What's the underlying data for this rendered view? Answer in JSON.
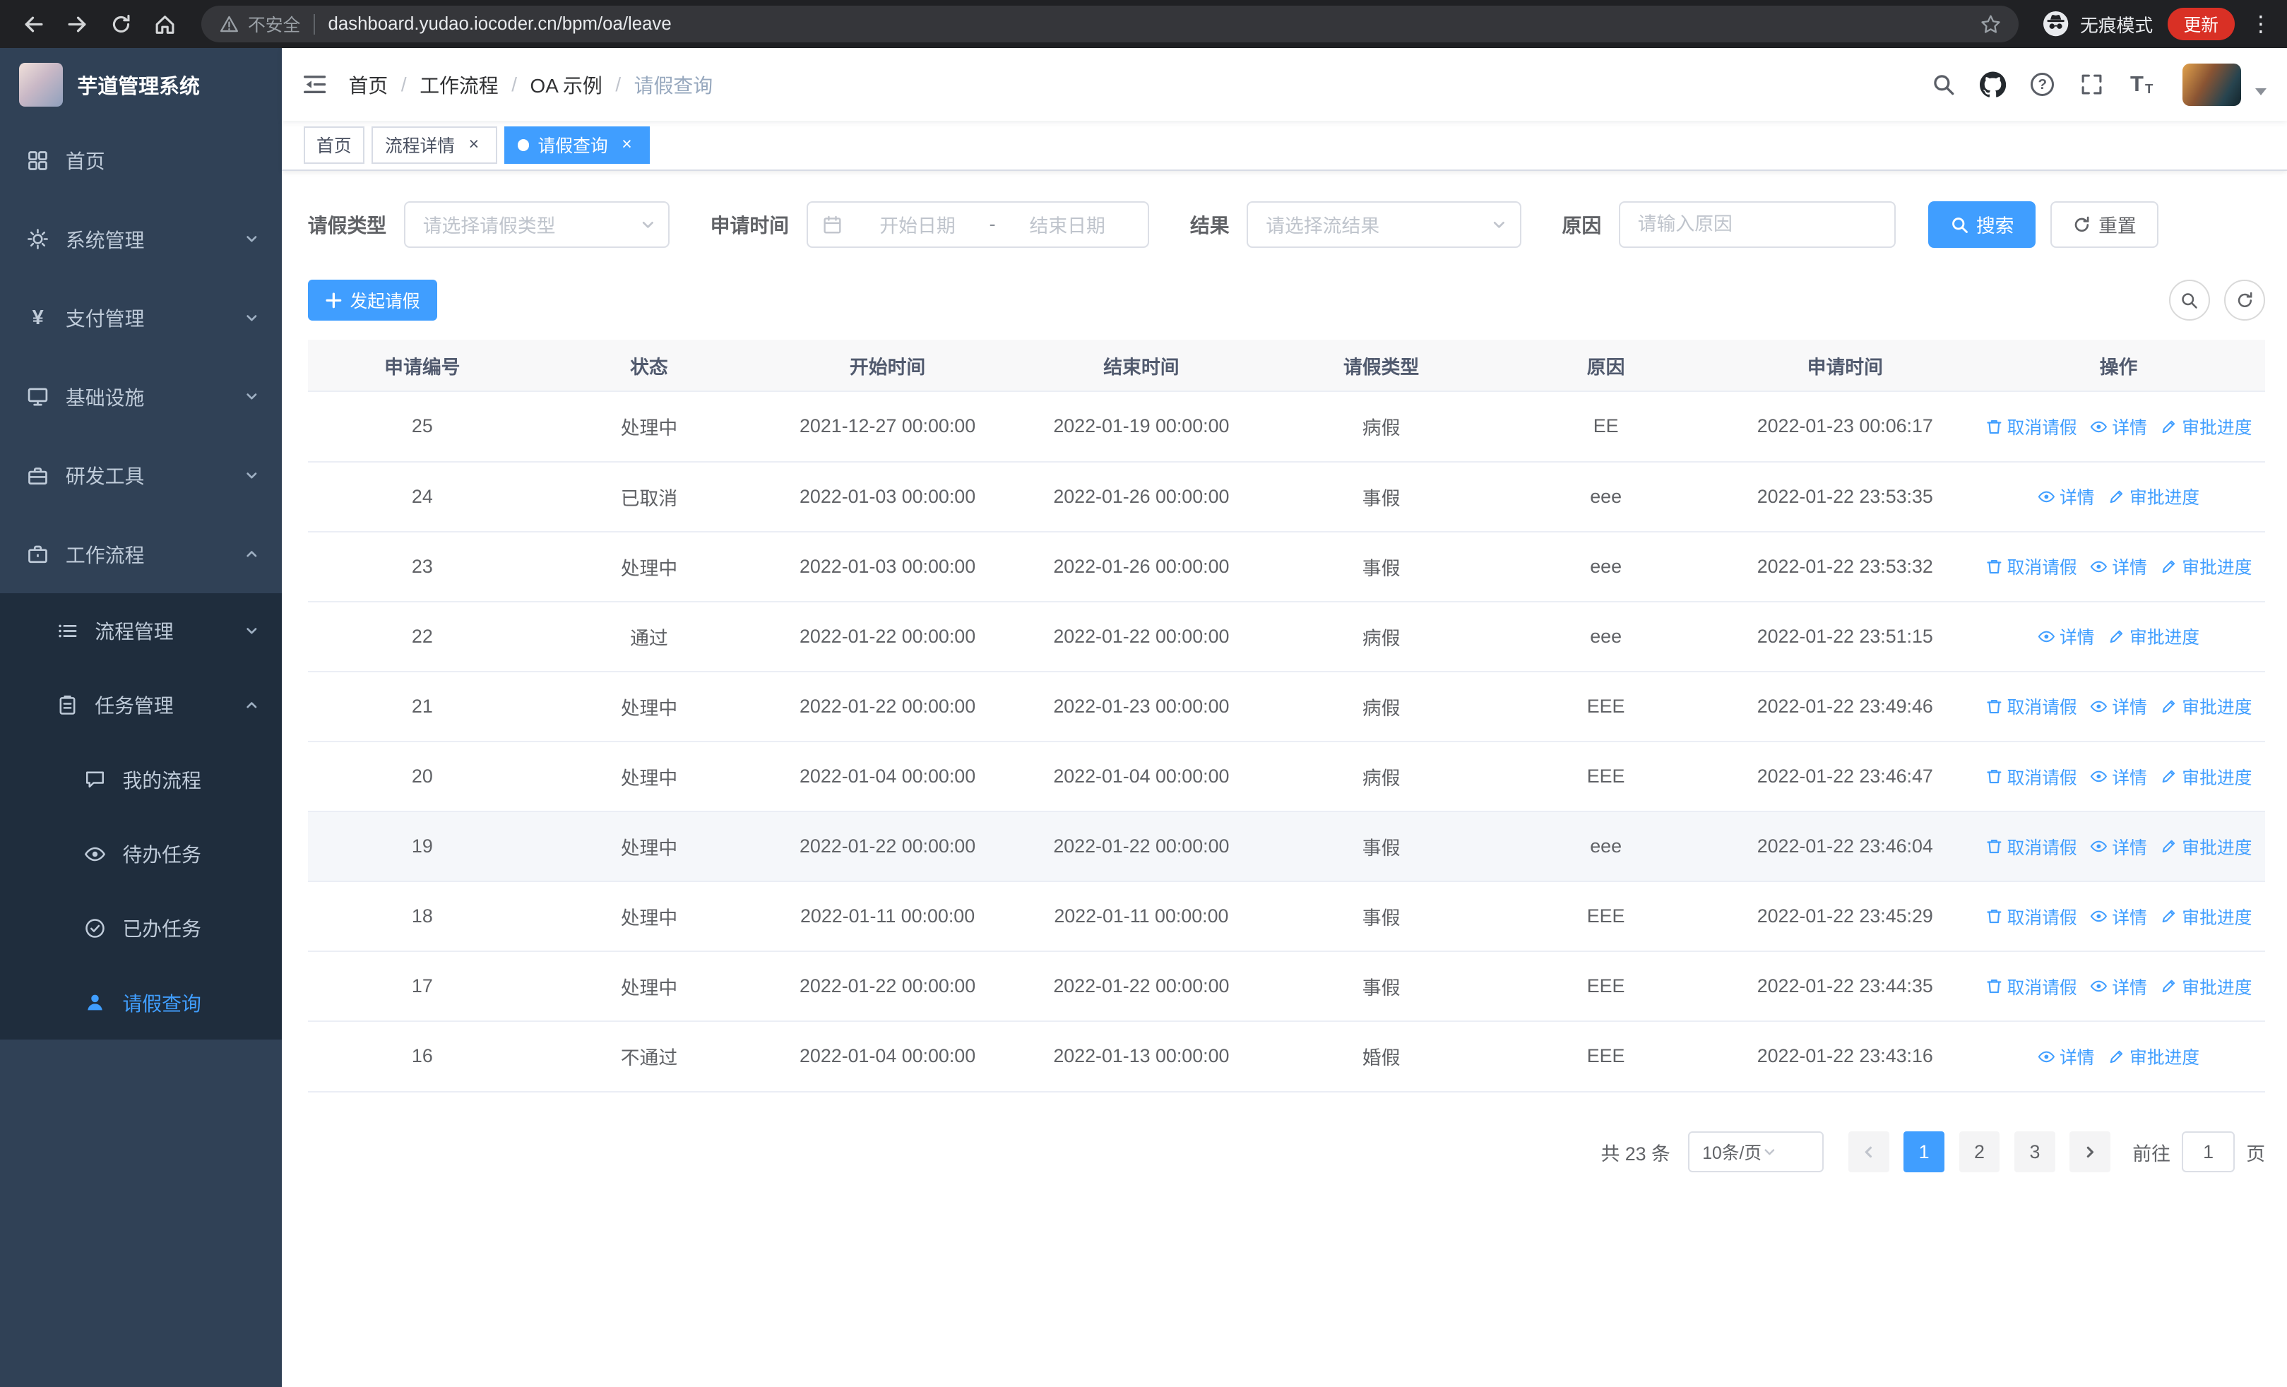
{
  "browser": {
    "security_label": "不安全",
    "url": "dashboard.yudao.iocoder.cn/bpm/oa/leave",
    "incognito_label": "无痕模式",
    "update_label": "更新"
  },
  "sidebar": {
    "app_title": "芋道管理系统",
    "items": [
      {
        "label": "首页",
        "level": 1
      },
      {
        "label": "系统管理",
        "level": 1,
        "chevron": "down"
      },
      {
        "label": "支付管理",
        "level": 1,
        "chevron": "down"
      },
      {
        "label": "基础设施",
        "level": 1,
        "chevron": "down"
      },
      {
        "label": "研发工具",
        "level": 1,
        "chevron": "down"
      },
      {
        "label": "工作流程",
        "level": 1,
        "chevron": "up",
        "expanded": true
      },
      {
        "label": "流程管理",
        "level": 2,
        "chevron": "down"
      },
      {
        "label": "任务管理",
        "level": 2,
        "chevron": "up",
        "expanded": true
      },
      {
        "label": "我的流程",
        "level": 3
      },
      {
        "label": "待办任务",
        "level": 3
      },
      {
        "label": "已办任务",
        "level": 3
      },
      {
        "label": "请假查询",
        "level": 3,
        "active": true
      }
    ]
  },
  "header": {
    "breadcrumb": [
      "首页",
      "工作流程",
      "OA 示例",
      "请假查询"
    ],
    "breadcrumb_separator": "/"
  },
  "tabs": [
    {
      "label": "首页",
      "active": false,
      "closable": false
    },
    {
      "label": "流程详情",
      "active": false,
      "closable": true
    },
    {
      "label": "请假查询",
      "active": true,
      "closable": true
    }
  ],
  "filters": {
    "leave_type_label": "请假类型",
    "leave_type_placeholder": "请选择请假类型",
    "apply_time_label": "申请时间",
    "start_date_placeholder": "开始日期",
    "range_separator": "-",
    "end_date_placeholder": "结束日期",
    "result_label": "结果",
    "result_placeholder": "请选择流结果",
    "reason_label": "原因",
    "reason_placeholder": "请输入原因",
    "search_button": "搜索",
    "reset_button": "重置"
  },
  "toolbar": {
    "create_button": "发起请假"
  },
  "table": {
    "columns": [
      "申请编号",
      "状态",
      "开始时间",
      "结束时间",
      "请假类型",
      "原因",
      "申请时间",
      "操作"
    ],
    "action_labels": {
      "cancel": "取消请假",
      "detail": "详情",
      "progress": "审批进度"
    },
    "rows": [
      {
        "id": "25",
        "status": "处理中",
        "start": "2021-12-27 00:00:00",
        "end": "2022-01-19 00:00:00",
        "type": "病假",
        "reason": "EE",
        "applied": "2022-01-23 00:06:17",
        "actions": [
          "cancel",
          "detail",
          "progress"
        ],
        "highlighted": false
      },
      {
        "id": "24",
        "status": "已取消",
        "start": "2022-01-03 00:00:00",
        "end": "2022-01-26 00:00:00",
        "type": "事假",
        "reason": "eee",
        "applied": "2022-01-22 23:53:35",
        "actions": [
          "detail",
          "progress"
        ],
        "highlighted": false
      },
      {
        "id": "23",
        "status": "处理中",
        "start": "2022-01-03 00:00:00",
        "end": "2022-01-26 00:00:00",
        "type": "事假",
        "reason": "eee",
        "applied": "2022-01-22 23:53:32",
        "actions": [
          "cancel",
          "detail",
          "progress"
        ],
        "highlighted": false
      },
      {
        "id": "22",
        "status": "通过",
        "start": "2022-01-22 00:00:00",
        "end": "2022-01-22 00:00:00",
        "type": "病假",
        "reason": "eee",
        "applied": "2022-01-22 23:51:15",
        "actions": [
          "detail",
          "progress"
        ],
        "highlighted": false
      },
      {
        "id": "21",
        "status": "处理中",
        "start": "2022-01-22 00:00:00",
        "end": "2022-01-23 00:00:00",
        "type": "病假",
        "reason": "EEE",
        "applied": "2022-01-22 23:49:46",
        "actions": [
          "cancel",
          "detail",
          "progress"
        ],
        "highlighted": false
      },
      {
        "id": "20",
        "status": "处理中",
        "start": "2022-01-04 00:00:00",
        "end": "2022-01-04 00:00:00",
        "type": "病假",
        "reason": "EEE",
        "applied": "2022-01-22 23:46:47",
        "actions": [
          "cancel",
          "detail",
          "progress"
        ],
        "highlighted": false
      },
      {
        "id": "19",
        "status": "处理中",
        "start": "2022-01-22 00:00:00",
        "end": "2022-01-22 00:00:00",
        "type": "事假",
        "reason": "eee",
        "applied": "2022-01-22 23:46:04",
        "actions": [
          "cancel",
          "detail",
          "progress"
        ],
        "highlighted": true
      },
      {
        "id": "18",
        "status": "处理中",
        "start": "2022-01-11 00:00:00",
        "end": "2022-01-11 00:00:00",
        "type": "事假",
        "reason": "EEE",
        "applied": "2022-01-22 23:45:29",
        "actions": [
          "cancel",
          "detail",
          "progress"
        ],
        "highlighted": false
      },
      {
        "id": "17",
        "status": "处理中",
        "start": "2022-01-22 00:00:00",
        "end": "2022-01-22 00:00:00",
        "type": "事假",
        "reason": "EEE",
        "applied": "2022-01-22 23:44:35",
        "actions": [
          "cancel",
          "detail",
          "progress"
        ],
        "highlighted": false
      },
      {
        "id": "16",
        "status": "不通过",
        "start": "2022-01-04 00:00:00",
        "end": "2022-01-13 00:00:00",
        "type": "婚假",
        "reason": "EEE",
        "applied": "2022-01-22 23:43:16",
        "actions": [
          "detail",
          "progress"
        ],
        "highlighted": false
      }
    ]
  },
  "pagination": {
    "total_text": "共 23 条",
    "page_size": "10条/页",
    "pages": [
      "1",
      "2",
      "3"
    ],
    "active_page": "1",
    "goto_label": "前往",
    "goto_value": "1",
    "page_suffix": "页"
  }
}
